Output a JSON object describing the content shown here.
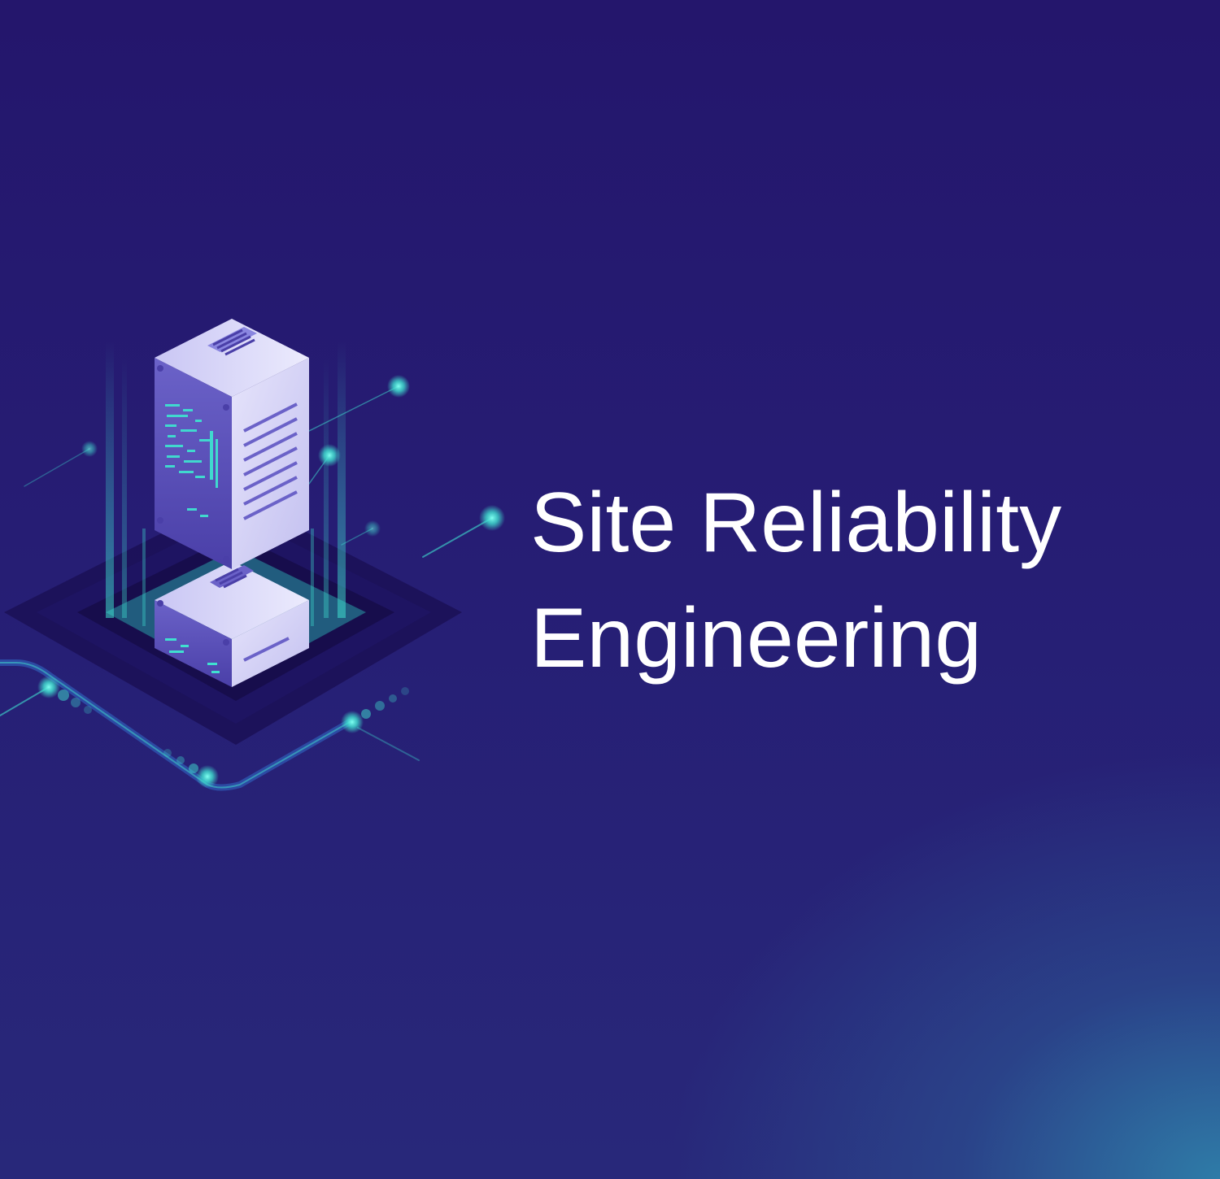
{
  "headline": {
    "line1": "Site Reliability",
    "line2": "Engineering"
  },
  "illustration": {
    "icon": "server-rack-icon"
  },
  "colors": {
    "background_top": "#24166c",
    "background_bottom_right": "#2f80aa",
    "accent_glow": "#3fe0d0",
    "server_light": "#dcdaf7",
    "server_side": "#8a86e0",
    "text": "#ffffff"
  }
}
